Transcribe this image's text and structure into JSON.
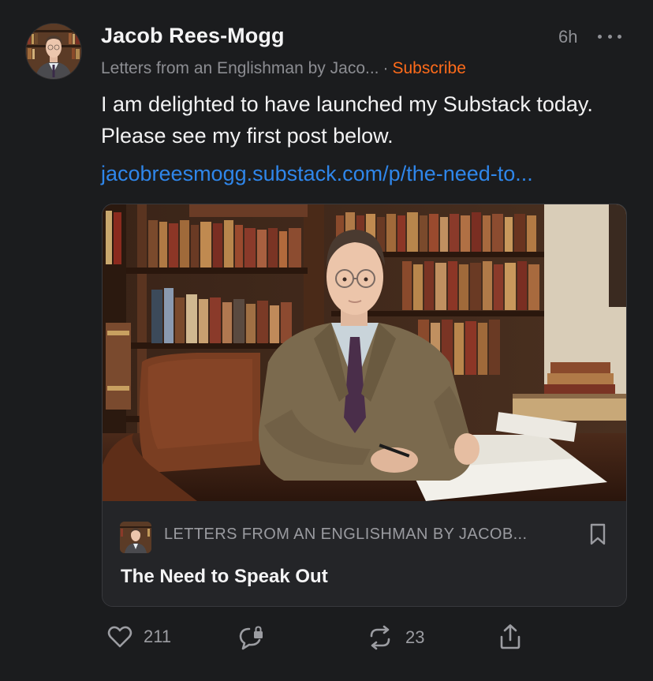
{
  "post": {
    "author": "Jacob Rees-Mogg",
    "time": "6h",
    "publication": "Letters from an Englishman by Jaco...",
    "separator": "·",
    "subscribe_label": "Subscribe",
    "body": "I am delighted to have launched my Substack today. Please see my first post below.",
    "link": "jacobreesmogg.substack.com/p/the-need-to..."
  },
  "card": {
    "publication": "LETTERS FROM AN ENGLISHMAN BY JACOB...",
    "title": "The Need to Speak Out"
  },
  "actions": {
    "likes": "211",
    "restacks": "23"
  },
  "icons": {
    "more": "more-horizontal-icon",
    "bookmark": "bookmark-icon",
    "like": "heart-icon",
    "comment": "comment-icon",
    "restack": "restack-icon",
    "share": "share-icon"
  },
  "colors": {
    "background": "#1b1c1e",
    "accent": "#ff6b1a",
    "link": "#2f86ea"
  }
}
